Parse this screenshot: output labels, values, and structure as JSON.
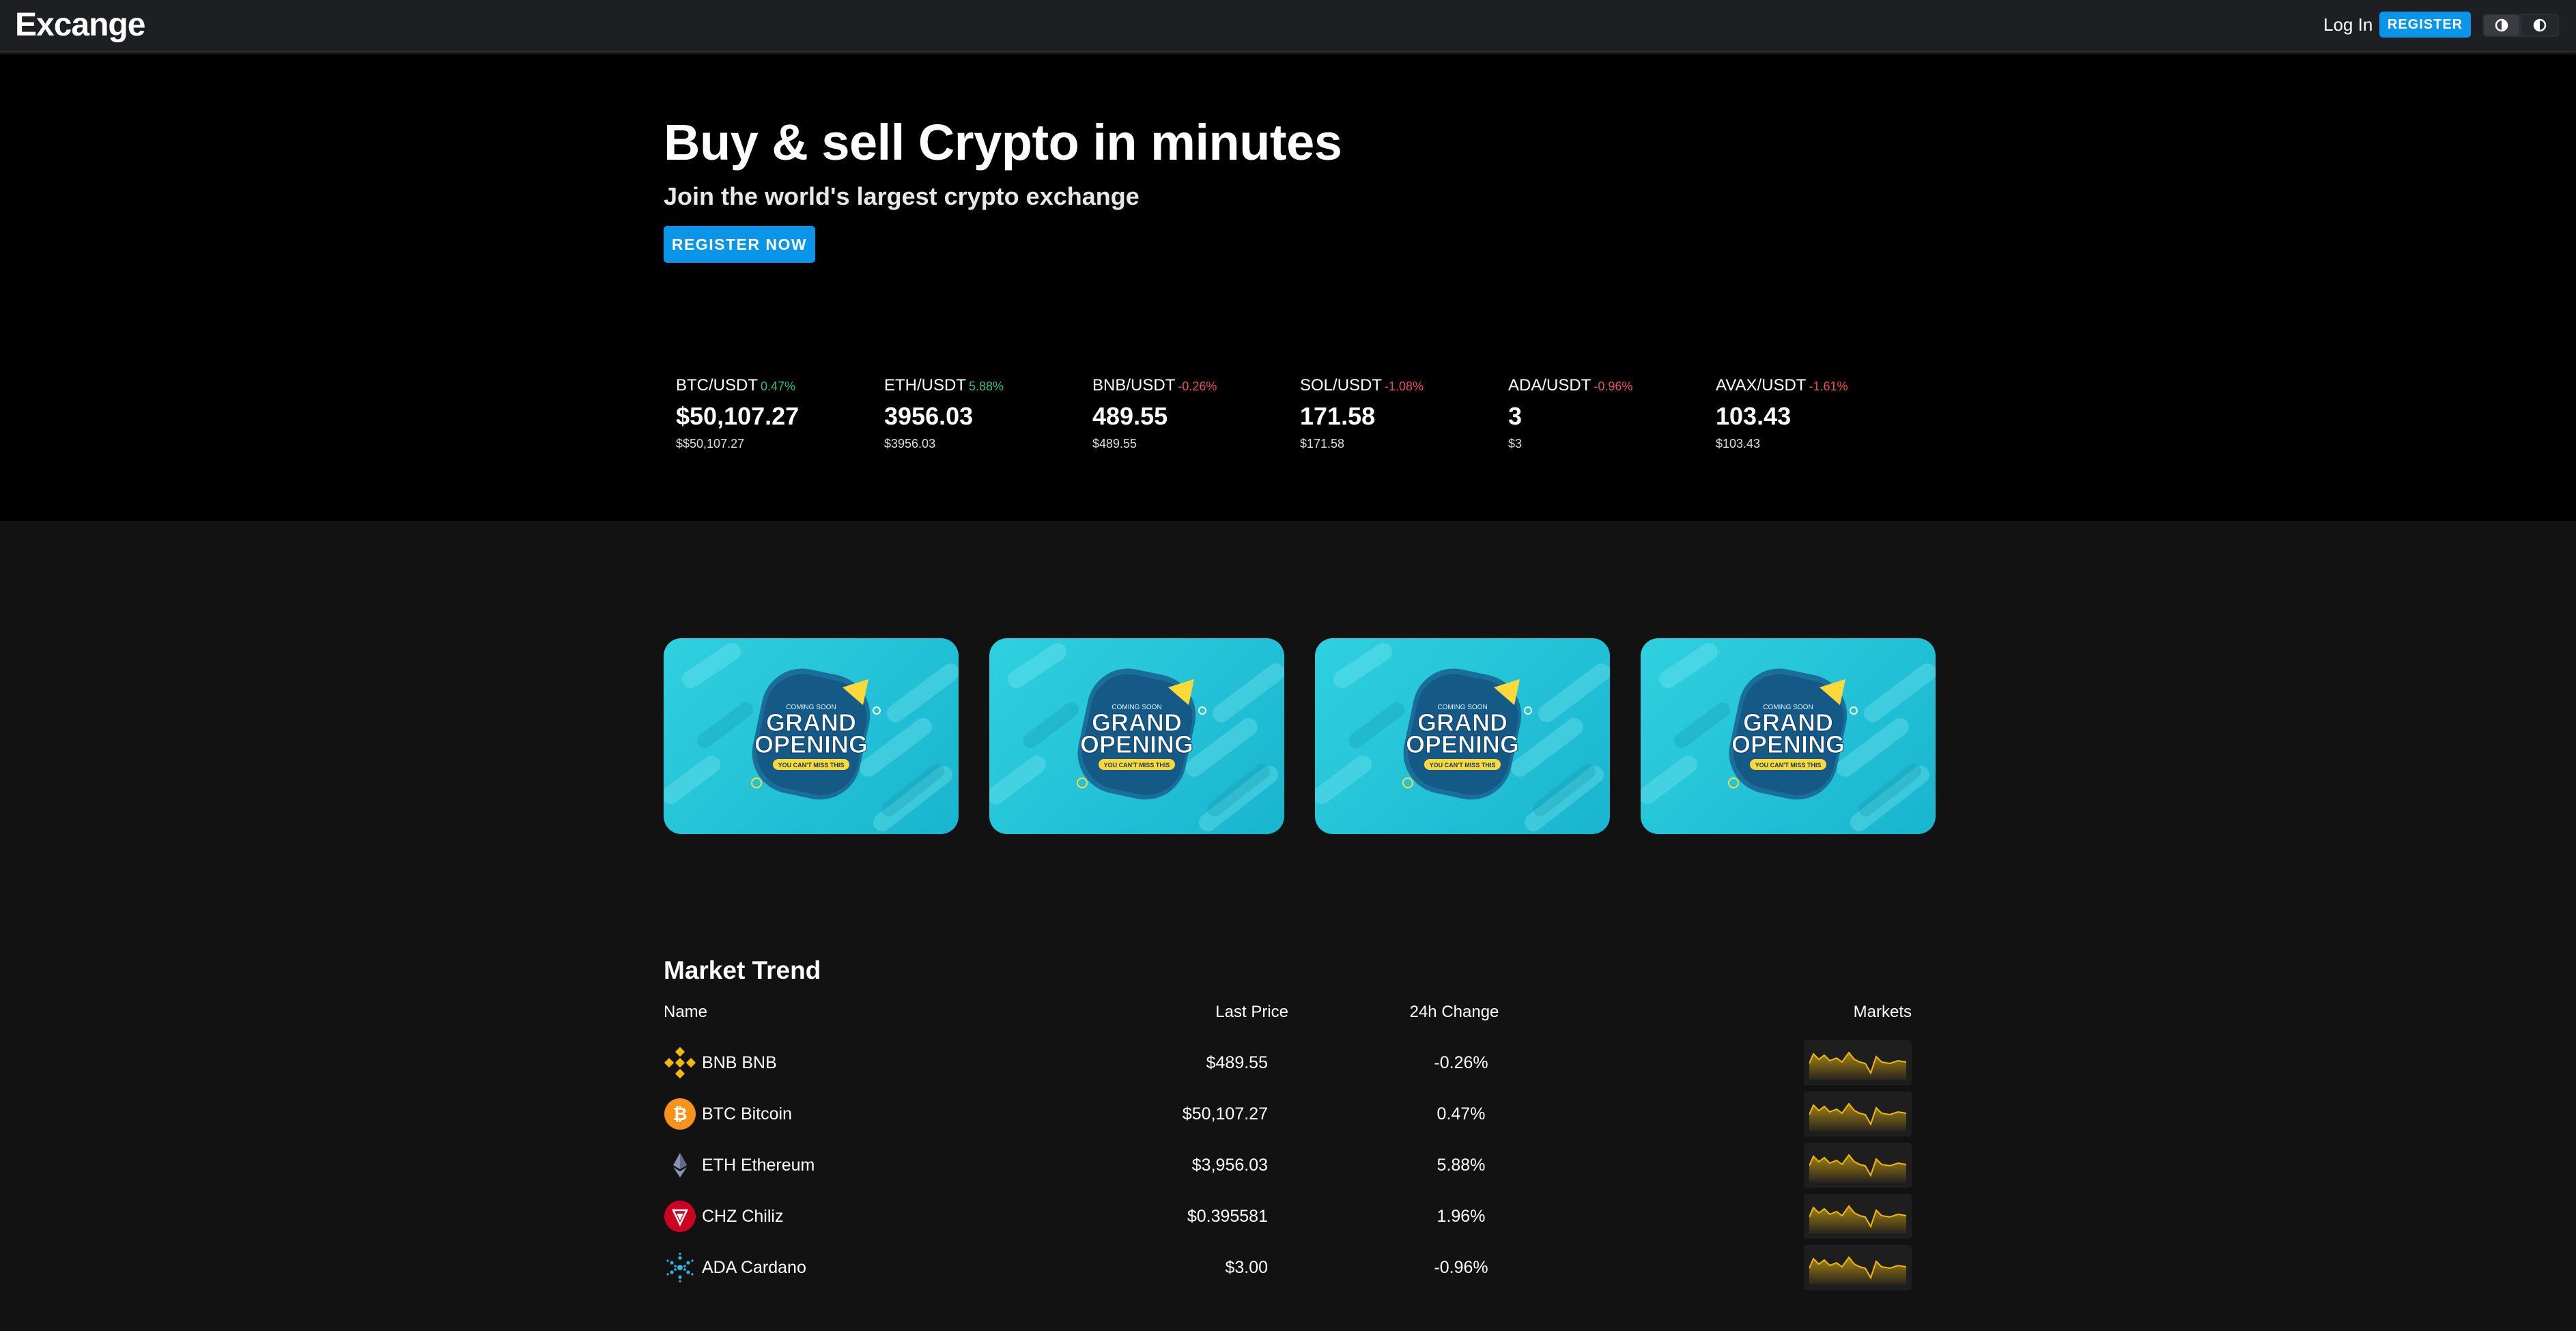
{
  "header": {
    "logo": "Excange",
    "login_label": "Log In",
    "register_label": "REGISTER",
    "theme_icons": [
      "light-theme-icon",
      "dark-theme-icon"
    ]
  },
  "hero": {
    "title": "Buy & sell Crypto in minutes",
    "subtitle": "Join the world's largest crypto exchange",
    "cta_label": "REGISTER NOW"
  },
  "tickers": [
    {
      "pair": "BTC/USDT",
      "change": "0.47%",
      "direction": "up",
      "price": "$50,107.27",
      "usd": "$$50,107.27"
    },
    {
      "pair": "ETH/USDT",
      "change": "5.88%",
      "direction": "up",
      "price": "3956.03",
      "usd": "$3956.03"
    },
    {
      "pair": "BNB/USDT",
      "change": "-0.26%",
      "direction": "down",
      "price": "489.55",
      "usd": "$489.55"
    },
    {
      "pair": "SOL/USDT",
      "change": "-1.08%",
      "direction": "down",
      "price": "171.58",
      "usd": "$171.58"
    },
    {
      "pair": "ADA/USDT",
      "change": "-0.96%",
      "direction": "down",
      "price": "3",
      "usd": "$3"
    },
    {
      "pair": "AVAX/USDT",
      "change": "-1.61%",
      "direction": "down",
      "price": "103.43",
      "usd": "$103.43"
    }
  ],
  "banners": [
    {
      "kicker": "COMING SOON",
      "line1": "GRAND",
      "line2": "OPENING",
      "tag": "YOU CAN'T MISS THIS"
    },
    {
      "kicker": "COMING SOON",
      "line1": "GRAND",
      "line2": "OPENING",
      "tag": "YOU CAN'T MISS THIS"
    },
    {
      "kicker": "COMING SOON",
      "line1": "GRAND",
      "line2": "OPENING",
      "tag": "YOU CAN'T MISS THIS"
    },
    {
      "kicker": "COMING SOON",
      "line1": "GRAND",
      "line2": "OPENING",
      "tag": "YOU CAN'T MISS THIS"
    }
  ],
  "market_trend": {
    "title": "Market Trend",
    "columns": {
      "name": "Name",
      "last_price": "Last Price",
      "change_24h": "24h Change",
      "markets": "Markets"
    },
    "rows": [
      {
        "symbol": "BNB",
        "name": "BNB BNB",
        "icon": "bnb-icon",
        "price": "$489.55",
        "change": "-0.26%"
      },
      {
        "symbol": "BTC",
        "name": "BTC Bitcoin",
        "icon": "btc-icon",
        "price": "$50,107.27",
        "change": "0.47%"
      },
      {
        "symbol": "ETH",
        "name": "ETH Ethereum",
        "icon": "eth-icon",
        "price": "$3,956.03",
        "change": "5.88%"
      },
      {
        "symbol": "CHZ",
        "name": "CHZ Chiliz",
        "icon": "chz-icon",
        "price": "$0.395581",
        "change": "1.96%"
      },
      {
        "symbol": "ADA",
        "name": "ADA Cardano",
        "icon": "ada-icon",
        "price": "$3.00",
        "change": "-0.96%"
      }
    ]
  },
  "colors": {
    "accent": "#0a95e8",
    "up": "#2ebd85",
    "down": "#e84f5a",
    "sparkline": "#f0b90b"
  }
}
